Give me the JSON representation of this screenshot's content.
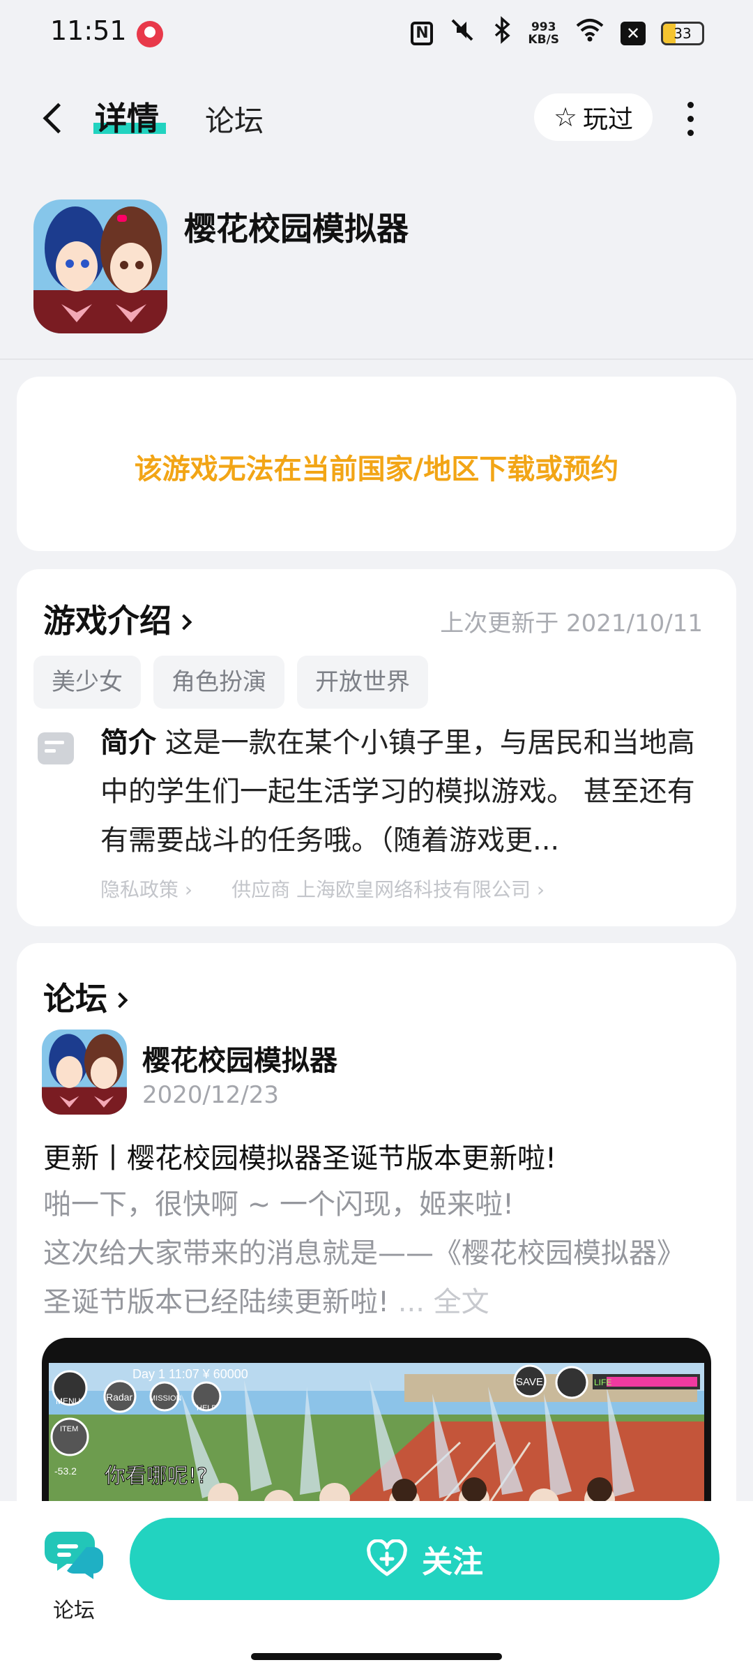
{
  "status_bar": {
    "time": "11:51",
    "network_speed_value": "993",
    "network_speed_unit": "KB/S",
    "battery": "33",
    "icons": [
      "app-notification-icon",
      "nfc-icon",
      "mute-icon",
      "bluetooth-icon",
      "wifi-icon",
      "close-box-icon",
      "battery-icon"
    ]
  },
  "header": {
    "tabs": [
      {
        "label": "详情",
        "active": true
      },
      {
        "label": "论坛",
        "active": false
      }
    ],
    "played_label": "玩过",
    "accent_color": "#22d3c0"
  },
  "app": {
    "title": "樱花校园模拟器"
  },
  "notice": {
    "text": "该游戏无法在当前国家/地区下载或预约",
    "color": "#f2a516"
  },
  "intro": {
    "title": "游戏介绍",
    "updated": "上次更新于 2021/10/11",
    "tags": [
      "美少女",
      "角色扮演",
      "开放世界"
    ],
    "summary_label": "简介",
    "summary_text": "这是一款在某个小镇子里，与居民和当地高中的学生们一起生活学习的模拟游戏。 甚至还有有需要战斗的任务哦。（随着游戏更...",
    "privacy_link": "隐私政策",
    "supplier_link": "供应商 上海欧皇网络科技有限公司"
  },
  "forum": {
    "title": "论坛",
    "post": {
      "author": "樱花校园模拟器",
      "date": "2020/12/23",
      "title": "更新丨樱花校园模拟器圣诞节版本更新啦!",
      "body_line1": "啪一下，很快啊 ~ 一个闪现，姬来啦!",
      "body_line2": "这次给大家带来的消息就是——《樱花校园模拟器》",
      "body_line3": "圣诞节版本已经陆续更新啦!",
      "more_label": "... 全文",
      "image": {
        "hud_day": "Day 1 11:07 ¥ 60000",
        "hud_menu": "MENU",
        "hud_radar": "Radar",
        "hud_mission": "MISSION",
        "hud_help": "HELP",
        "hud_save": "SAVE",
        "hud_life": "LIFE",
        "hud_item": "ITEM",
        "hud_dialog": "你看哪呢!?",
        "hud_value": "-53.2"
      }
    }
  },
  "bottom_bar": {
    "forum_label": "论坛",
    "follow_label": "关注"
  }
}
